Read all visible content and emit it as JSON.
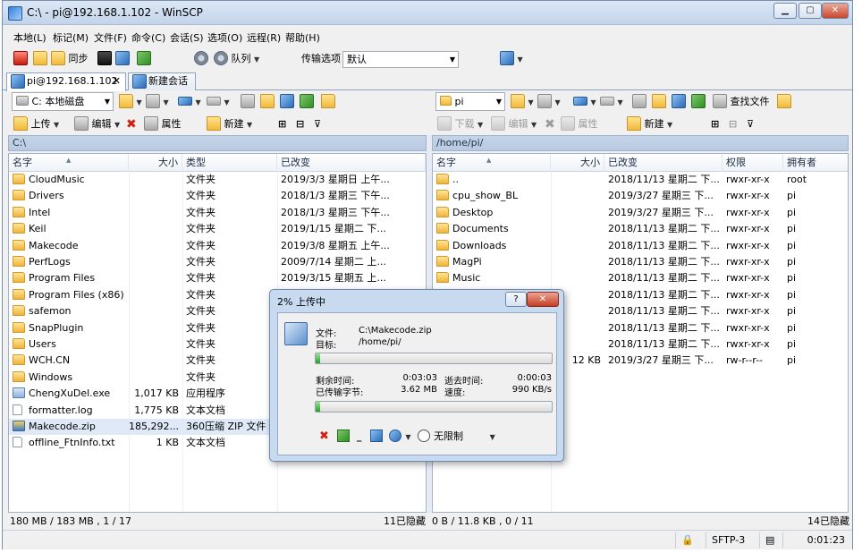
{
  "window": {
    "title": "C:\\ - pi@192.168.1.102 - WinSCP",
    "min": "▁",
    "max": "▢",
    "close": "✕"
  },
  "menu": [
    "本地(L)",
    "标记(M)",
    "文件(F)",
    "命令(C)",
    "会话(S)",
    "选项(O)",
    "远程(R)",
    "帮助(H)"
  ],
  "toolbar1": {
    "sync_label": "同步",
    "queue_label": "队列",
    "transfer_label": "传输选项",
    "transfer_value": "默认"
  },
  "tabs": {
    "session": "pi@192.168.1.102",
    "new_session": "新建会话",
    "close": "✕"
  },
  "left": {
    "drive": "C: 本地磁盘",
    "upload": "上传",
    "edit": "编辑",
    "props": "属性",
    "new": "新建",
    "path": "C:\\",
    "headers": [
      "名字",
      "大小",
      "类型",
      "已改变"
    ],
    "rows": [
      {
        "name": "CloudMusic",
        "size": "",
        "type": "文件夹",
        "changed": "2019/3/3 星期日 上午...",
        "icon": "folder"
      },
      {
        "name": "Drivers",
        "size": "",
        "type": "文件夹",
        "changed": "2018/1/3 星期三  下午...",
        "icon": "folder"
      },
      {
        "name": "Intel",
        "size": "",
        "type": "文件夹",
        "changed": "2018/1/3 星期三  下午...",
        "icon": "folder"
      },
      {
        "name": "Keil",
        "size": "",
        "type": "文件夹",
        "changed": "2019/1/15 星期二  下...",
        "icon": "folder"
      },
      {
        "name": "Makecode",
        "size": "",
        "type": "文件夹",
        "changed": "2019/3/8 星期五  上午...",
        "icon": "folder"
      },
      {
        "name": "PerfLogs",
        "size": "",
        "type": "文件夹",
        "changed": "2009/7/14 星期二  上...",
        "icon": "folder"
      },
      {
        "name": "Program Files",
        "size": "",
        "type": "文件夹",
        "changed": "2019/3/15 星期五  上...",
        "icon": "folder"
      },
      {
        "name": "Program Files (x86)",
        "size": "",
        "type": "文件夹",
        "changed": "",
        "icon": "folder"
      },
      {
        "name": "safemon",
        "size": "",
        "type": "文件夹",
        "changed": "",
        "icon": "folder"
      },
      {
        "name": "SnapPlugin",
        "size": "",
        "type": "文件夹",
        "changed": "",
        "icon": "folder"
      },
      {
        "name": "Users",
        "size": "",
        "type": "文件夹",
        "changed": "",
        "icon": "folder"
      },
      {
        "name": "WCH.CN",
        "size": "",
        "type": "文件夹",
        "changed": "",
        "icon": "folder"
      },
      {
        "name": "Windows",
        "size": "",
        "type": "文件夹",
        "changed": "",
        "icon": "folder"
      },
      {
        "name": "ChengXuDel.exe",
        "size": "1,017 KB",
        "type": "应用程序",
        "changed": "",
        "icon": "exe"
      },
      {
        "name": "formatter.log",
        "size": "1,775 KB",
        "type": "文本文档",
        "changed": "",
        "icon": "doc"
      },
      {
        "name": "Makecode.zip",
        "size": "185,292...",
        "type": "360压缩 ZIP 文件",
        "changed": "",
        "icon": "zip",
        "selected": true
      },
      {
        "name": "offline_FtnInfo.txt",
        "size": "1 KB",
        "type": "文本文档",
        "changed": "",
        "icon": "doc"
      }
    ],
    "status": "180 MB / 183 MB ,  1 / 17",
    "hidden": "11已隐藏"
  },
  "right": {
    "folder": "pi",
    "download": "下载",
    "edit": "编辑",
    "props": "属性",
    "new": "新建",
    "find": "查找文件",
    "path": "/home/pi/",
    "headers": [
      "名字",
      "大小",
      "已改变",
      "权限",
      "拥有者"
    ],
    "rows": [
      {
        "name": "..",
        "size": "",
        "changed": "2018/11/13 星期二  下...",
        "rights": "rwxr-xr-x",
        "owner": "root",
        "icon": "up"
      },
      {
        "name": "cpu_show_BL",
        "size": "",
        "changed": "2019/3/27 星期三  下...",
        "rights": "rwxr-xr-x",
        "owner": "pi",
        "icon": "folder"
      },
      {
        "name": "Desktop",
        "size": "",
        "changed": "2019/3/27 星期三  下...",
        "rights": "rwxr-xr-x",
        "owner": "pi",
        "icon": "folder"
      },
      {
        "name": "Documents",
        "size": "",
        "changed": "2018/11/13 星期二  下...",
        "rights": "rwxr-xr-x",
        "owner": "pi",
        "icon": "folder"
      },
      {
        "name": "Downloads",
        "size": "",
        "changed": "2018/11/13 星期二  下...",
        "rights": "rwxr-xr-x",
        "owner": "pi",
        "icon": "folder"
      },
      {
        "name": "MagPi",
        "size": "",
        "changed": "2018/11/13 星期二  下...",
        "rights": "rwxr-xr-x",
        "owner": "pi",
        "icon": "folder"
      },
      {
        "name": "Music",
        "size": "",
        "changed": "2018/11/13 星期二  下...",
        "rights": "rwxr-xr-x",
        "owner": "pi",
        "icon": "folder"
      },
      {
        "name": "",
        "size": "",
        "changed": "2018/11/13 星期二  下...",
        "rights": "rwxr-xr-x",
        "owner": "pi",
        "icon": ""
      },
      {
        "name": "",
        "size": "",
        "changed": "2018/11/13 星期二  下...",
        "rights": "rwxr-xr-x",
        "owner": "pi",
        "icon": ""
      },
      {
        "name": "",
        "size": "",
        "changed": "2018/11/13 星期二  下...",
        "rights": "rwxr-xr-x",
        "owner": "pi",
        "icon": ""
      },
      {
        "name": "",
        "size": "",
        "changed": "2018/11/13 星期二  下...",
        "rights": "rwxr-xr-x",
        "owner": "pi",
        "icon": ""
      },
      {
        "name": "",
        "size": "12 KB",
        "changed": "2019/3/27 星期三  下...",
        "rights": "rw-r--r--",
        "owner": "pi",
        "icon": ""
      }
    ],
    "status": "0 B / 11.8 KB ,  0 / 11",
    "hidden": "14已隐藏"
  },
  "bottom": {
    "protocol": "SFTP-3",
    "elapsed": "0:01:23"
  },
  "dialog": {
    "title": "2% 上传中",
    "help": "?",
    "close": "✕",
    "file_label": "文件:",
    "file_value": "C:\\Makecode.zip",
    "target_label": "目标:",
    "target_value": "/home/pi/",
    "file_progress": 0.02,
    "remaining_label": "剩余时间:",
    "remaining_value": "0:03:03",
    "elapsed_label": "逝去时间:",
    "elapsed_value": "0:00:03",
    "transferred_label": "已传输字节:",
    "transferred_value": "3.62 MB",
    "speed_label": "速度:",
    "speed_value": "990 KB/s",
    "total_progress": 0.02,
    "speed_limit": "无限制"
  }
}
